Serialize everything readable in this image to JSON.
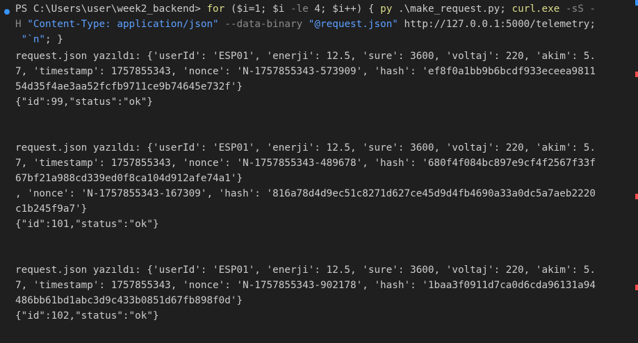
{
  "prompt": {
    "ps": "PS C:\\Users\\user\\week2_backend> ",
    "for_kw": "for",
    "cond1": " ($i=1; ",
    "var_i": "$i",
    "le": " -le ",
    "cond2": "4; ",
    "inc": "$i++",
    "brace": ") { ",
    "py": "py",
    "script": " .\\make_request.py; ",
    "curl": "curl.exe",
    "sS": " -sS -",
    "line2_H": "H ",
    "content_type": "\"Content-Type: application/json\"",
    "data_bin": " --data-binary ",
    "req_file": "\"@request.json\"",
    "url": " http://127.0.0.1:5000/telemetry;",
    "line3_nl": " \"`n\"",
    "line3_end": "; }"
  },
  "output": [
    "request.json yazıldı: {'userId': 'ESP01', 'enerji': 12.5, 'sure': 3600, 'voltaj': 220, 'akim': 5.",
    "7, 'timestamp': 1757855343, 'nonce': 'N-1757855343-573909', 'hash': 'ef8f0a1bb9b6bcdf933eceea9811",
    "54d35f4ae3aa52fcfb9711ce9b74645e732f'}",
    "{\"id\":99,\"status\":\"ok\"}",
    "request.json yazıldı: {'userId': 'ESP01', 'enerji': 12.5, 'sure': 3600, 'voltaj': 220, 'akim': 5.",
    "7, 'timestamp': 1757855343, 'nonce': 'N-1757855343-489678', 'hash': '680f4f084bc897e9cf4f2567f33f",
    "67bf21a988cd339ed0f8ca104d912afe74a1'}",
    ", 'nonce': 'N-1757855343-167309', 'hash': '816a78d4d9ec51c8271d627ce45d9d4fb4690a33a0dc5a7aeb2220",
    "c1b245f9a7'}",
    "{\"id\":101,\"status\":\"ok\"}",
    "request.json yazıldı: {'userId': 'ESP01', 'enerji': 12.5, 'sure': 3600, 'voltaj': 220, 'akim': 5.",
    "7, 'timestamp': 1757855343, 'nonce': 'N-1757855343-902178', 'hash': '1baa3f0911d7ca0d6cda96131a94",
    "486bb61bd1abc3d9c433b0851d67fb898f0d'}",
    "{\"id\":102,\"status\":\"ok\"}"
  ],
  "colors": {
    "background": "#1f1f1f",
    "text": "#cccccc",
    "command_yellow": "#dcdc8b",
    "param_gray": "#8a8a8a",
    "string_blue": "#5ea0ff",
    "prompt_dot": "#3794ff",
    "error_marker": "#f14c4c"
  }
}
